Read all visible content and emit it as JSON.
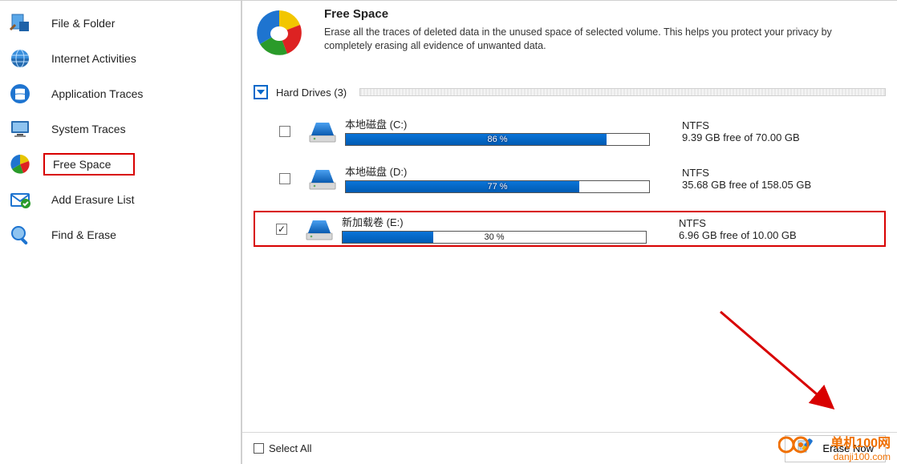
{
  "sidebar": {
    "items": [
      {
        "label": "File & Folder",
        "icon": "file-folder"
      },
      {
        "label": "Internet Activities",
        "icon": "globe"
      },
      {
        "label": "Application Traces",
        "icon": "windows"
      },
      {
        "label": "System Traces",
        "icon": "monitor"
      },
      {
        "label": "Free Space",
        "icon": "pie",
        "highlight": true
      },
      {
        "label": "Add Erasure List",
        "icon": "mail-checked"
      },
      {
        "label": "Find & Erase",
        "icon": "search"
      }
    ]
  },
  "header": {
    "title": "Free Space",
    "description": "Erase all the traces of deleted data in the unused space of selected volume. This helps you protect your privacy by completely erasing all evidence of unwanted data."
  },
  "section": {
    "label": "Hard Drives (3)"
  },
  "drives": [
    {
      "name": "本地磁盘 (C:)",
      "pct": 86,
      "pct_label": "86 %",
      "fs": "NTFS",
      "free": "9.39 GB free of 70.00 GB",
      "checked": false,
      "highlight": false
    },
    {
      "name": "本地磁盘 (D:)",
      "pct": 77,
      "pct_label": "77 %",
      "fs": "NTFS",
      "free": "35.68 GB free of 158.05 GB",
      "checked": false,
      "highlight": false
    },
    {
      "name": "新加载卷 (E:)",
      "pct": 30,
      "pct_label": "30 %",
      "fs": "NTFS",
      "free": "6.96 GB free of 10.00 GB",
      "checked": true,
      "highlight": true
    }
  ],
  "footer": {
    "select_all_label": "Select All",
    "erase_label": "Erase Now"
  },
  "watermark": {
    "line1": "单机100网",
    "line2": "danji100.com"
  },
  "colors": {
    "highlight_border": "#d80000",
    "progress_fill": "#005bb3"
  }
}
